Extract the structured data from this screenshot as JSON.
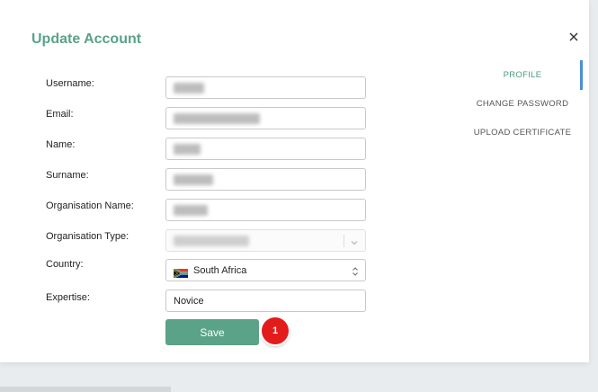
{
  "modal": {
    "title": "Update Account",
    "close_icon": "close-icon"
  },
  "form": {
    "username_label": "Username:",
    "email_label": "Email:",
    "name_label": "Name:",
    "surname_label": "Surname:",
    "org_name_label": "Organisation Name:",
    "org_type_label": "Organisation Type:",
    "country_label": "Country:",
    "country_value": "South Africa",
    "country_flag_icon": "south-africa-flag-icon",
    "expertise_label": "Expertise:",
    "expertise_value": "Novice",
    "save_label": "Save"
  },
  "annotation": {
    "badge_number": "1",
    "badge_color": "#e31b1b"
  },
  "side_nav": {
    "tabs": [
      {
        "label": "PROFILE",
        "active": true
      },
      {
        "label": "CHANGE PASSWORD",
        "active": false
      },
      {
        "label": "UPLOAD CERTIFICATE",
        "active": false
      }
    ]
  },
  "colors": {
    "accent": "#5aa288",
    "active_tab": "#4a9a80",
    "tab_indicator": "#4a8fd6"
  }
}
